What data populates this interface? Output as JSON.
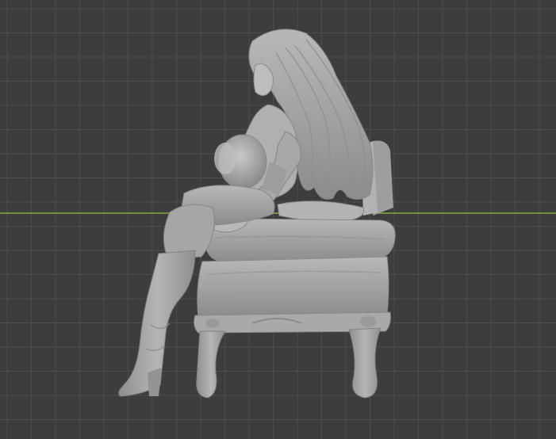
{
  "viewport": {
    "view": "3D viewport",
    "background_color": "#3d3d3d",
    "grid_color": "#4d4d4d",
    "x_axis_color": "#7fae3f",
    "model_color": "#a6a6a6"
  },
  "model": {
    "description_icon": "seated-figure-on-sofa-mesh"
  }
}
